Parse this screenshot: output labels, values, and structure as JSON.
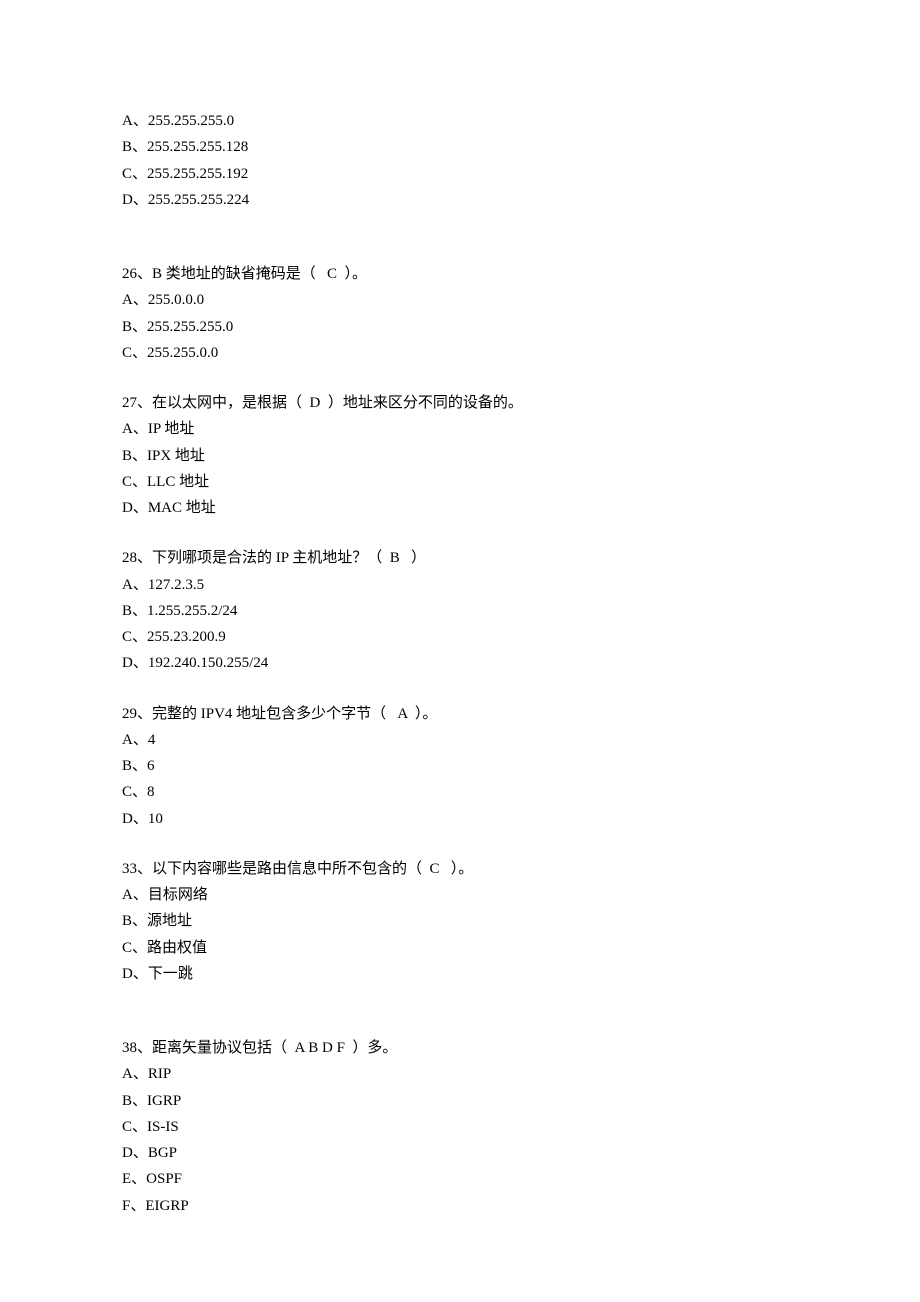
{
  "q25_opts": {
    "items": [
      "A、255.255.255.0",
      "B、255.255.255.128",
      "C、255.255.255.192",
      "D、255.255.255.224"
    ]
  },
  "q26": {
    "stem": "26、B 类地址的缺省掩码是（   C  ）。",
    "items": [
      "A、255.0.0.0",
      "B、255.255.255.0",
      "C、255.255.0.0"
    ]
  },
  "q27": {
    "stem": "27、在以太网中，是根据（  D  ）地址来区分不同的设备的。",
    "items": [
      "A、IP 地址",
      "B、IPX 地址",
      "C、LLC 地址",
      "D、MAC 地址"
    ]
  },
  "q28": {
    "stem": "28、下列哪项是合法的 IP 主机地址？（  B   ）",
    "items": [
      "A、127.2.3.5",
      "B、1.255.255.2/24",
      "C、255.23.200.9",
      "D、192.240.150.255/24"
    ]
  },
  "q29": {
    "stem": "29、完整的 IPV4 地址包含多少个字节（   A  ）。",
    "items": [
      "A、4",
      "B、6",
      "C、8",
      "D、10"
    ]
  },
  "q33": {
    "stem": "33、以下内容哪些是路由信息中所不包含的（  C   ）。",
    "items": [
      "A、目标网络",
      "B、源地址",
      "C、路由权值",
      "D、下一跳"
    ]
  },
  "q38": {
    "stem": "38、距离矢量协议包括（  A B D F  ）多。",
    "items": [
      "A、RIP",
      "B、IGRP",
      "C、IS-IS",
      "D、BGP",
      "E、OSPF",
      "F、EIGRP"
    ]
  }
}
